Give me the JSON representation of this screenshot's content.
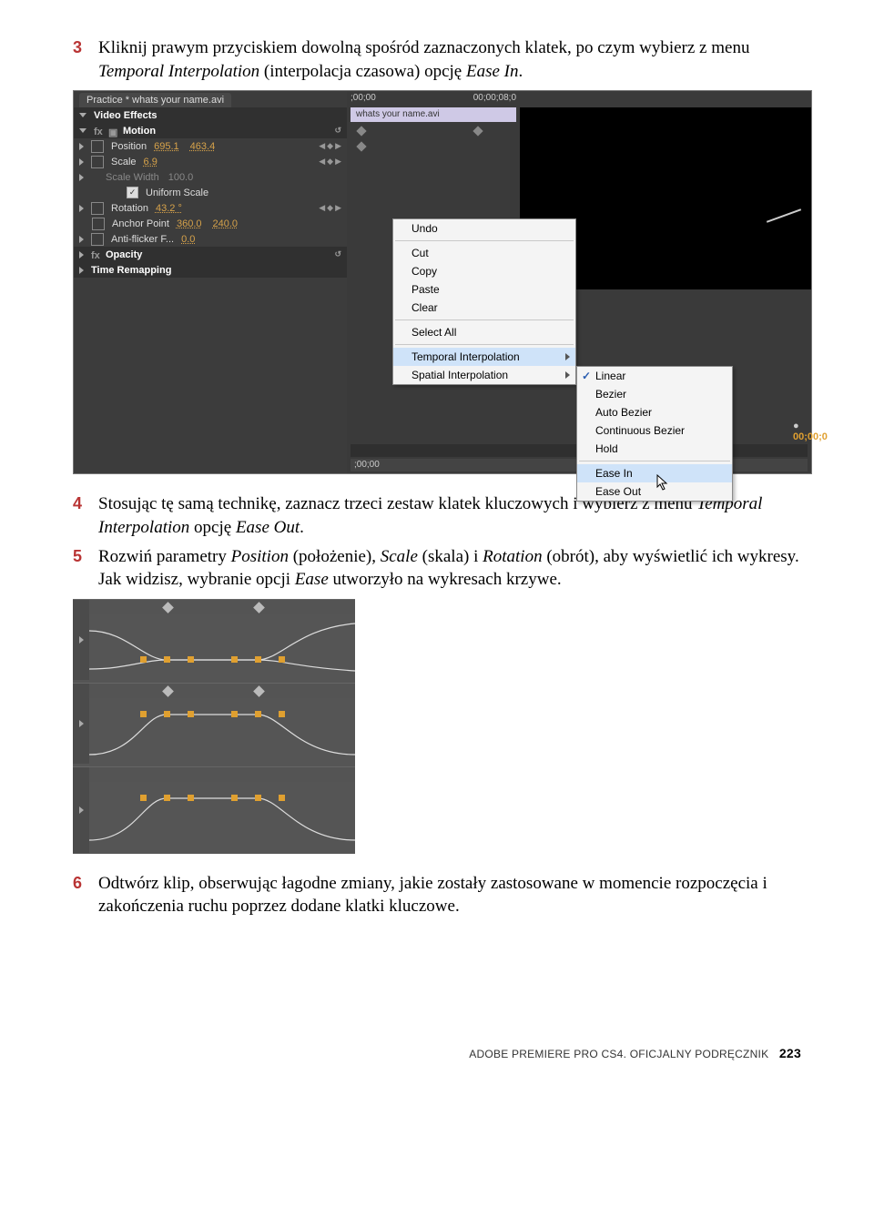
{
  "steps": {
    "s3": {
      "num": "3",
      "text_a": "Kliknij prawym przyciskiem dowolną spośród zaznaczonych klatek, po czym wybierz z menu ",
      "i1": "Temporal Interpolation",
      "text_b": " (interpolacja czasowa) opcję ",
      "i2": "Ease In",
      "text_c": "."
    },
    "s4": {
      "num": "4",
      "text_a": "Stosując tę samą technikę, zaznacz trzeci zestaw klatek kluczowych i wybierz z menu ",
      "i1": "Temporal Interpolation",
      "text_b": " opcję ",
      "i2": "Ease Out",
      "text_c": "."
    },
    "s5": {
      "num": "5",
      "text_a": "Rozwiń parametry ",
      "i1": "Position",
      "text_b": " (położenie), ",
      "i2": "Scale",
      "text_c": " (skala) i ",
      "i3": "Rotation",
      "text_d": " (obrót), aby wyświetlić ich wykresy. Jak widzisz, wybranie opcji ",
      "i4": "Ease",
      "text_e": " utworzyło na wykresach krzywe."
    },
    "s6": {
      "num": "6",
      "text": "Odtwórz klip, obserwując łagodne zmiany, jakie zostały zastosowane w momencie rozpoczęcia i zakończenia ruchu poprzez dodane klatki kluczowe."
    }
  },
  "panel": {
    "tab": "Practice * whats your name.avi",
    "header": "Video Effects",
    "clip": "whats your name.avi",
    "tick_left": ";00;00",
    "tick_right": "00;00;08;0",
    "playhead_tc": "00;00;0",
    "bottom_tc": ";00;00",
    "effects": {
      "motion": "Motion",
      "position": {
        "label": "Position",
        "x": "695.1",
        "y": "463.4"
      },
      "scale": {
        "label": "Scale",
        "v": "6.9"
      },
      "scalewidth": {
        "label": "Scale Width",
        "v": "100.0"
      },
      "uniform": {
        "label": "Uniform Scale"
      },
      "rotation": {
        "label": "Rotation",
        "v": "43.2 °"
      },
      "anchor": {
        "label": "Anchor Point",
        "x": "360.0",
        "y": "240.0"
      },
      "antiflicker": {
        "label": "Anti-flicker F...",
        "v": "0.0"
      },
      "opacity": "Opacity",
      "timeremap": "Time Remapping"
    }
  },
  "menu1": {
    "undo": "Undo",
    "cut": "Cut",
    "copy": "Copy",
    "paste": "Paste",
    "clear": "Clear",
    "selectall": "Select All",
    "temporal": "Temporal Interpolation",
    "spatial": "Spatial Interpolation"
  },
  "menu2": {
    "linear": "Linear",
    "bezier": "Bezier",
    "autobezier": "Auto Bezier",
    "contbezier": "Continuous Bezier",
    "hold": "Hold",
    "easein": "Ease In",
    "easeout": "Ease Out"
  },
  "footer": {
    "book": "ADOBE PREMIERE PRO CS4. OFICJALNY PODRĘCZNIK",
    "page": "223"
  }
}
